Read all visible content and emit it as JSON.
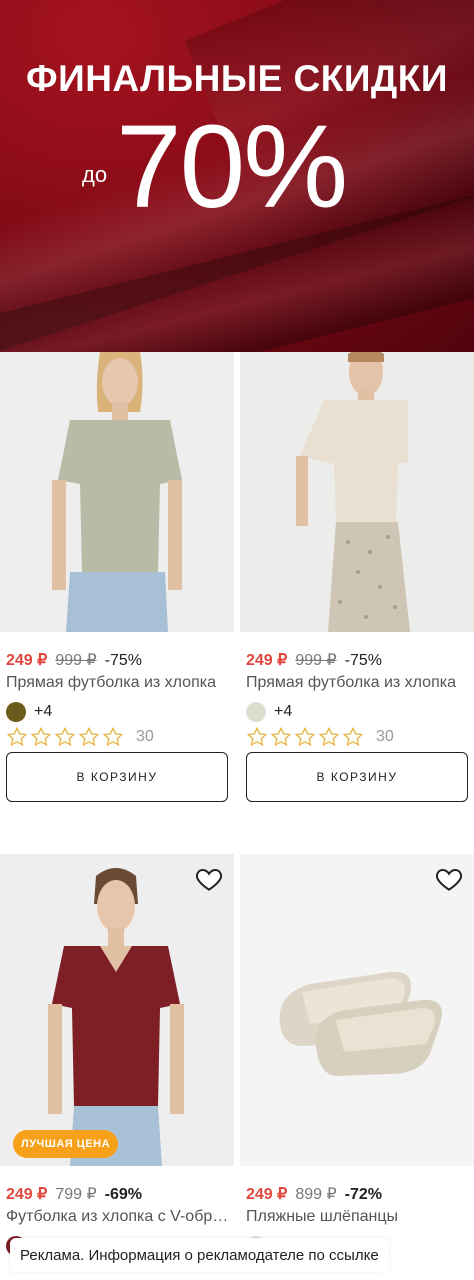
{
  "banner": {
    "title": "ФИНАЛЬНЫЕ СКИДКИ",
    "prefix": "до",
    "value": "70%"
  },
  "products": [
    {
      "price": "249 ₽",
      "old_price": "999 ₽",
      "discount": "-75%",
      "title": "Прямая футболка из хлопка",
      "swatch_color": "#6b5b1c",
      "more_colors": "+4",
      "reviews": "30",
      "cart_label": "В КОРЗИНУ"
    },
    {
      "price": "249 ₽",
      "old_price": "999 ₽",
      "discount": "-75%",
      "title": "Прямая футболка из хлопка",
      "swatch_color": "#dcdccf",
      "more_colors": "+4",
      "reviews": "30",
      "cart_label": "В КОРЗИНУ"
    },
    {
      "price": "249 ₽",
      "old_price": "799 ₽",
      "discount": "-69%",
      "title": "Футболка из хлопка с V-образным вырезом",
      "badge": "ЛУЧШАЯ ЦЕНА",
      "swatch_color": "#7a1e22"
    },
    {
      "price": "249 ₽",
      "old_price": "899 ₽",
      "discount": "-72%",
      "title": "Пляжные шлёпанцы",
      "swatch_color": "#dcdcdc"
    }
  ],
  "ad_notice": "Реклама. Информация о рекламодателе по ссылке",
  "colors": {
    "price_red": "#e0473f",
    "badge_orange": "#f7a11a",
    "banner_red": "#8c0c18"
  }
}
